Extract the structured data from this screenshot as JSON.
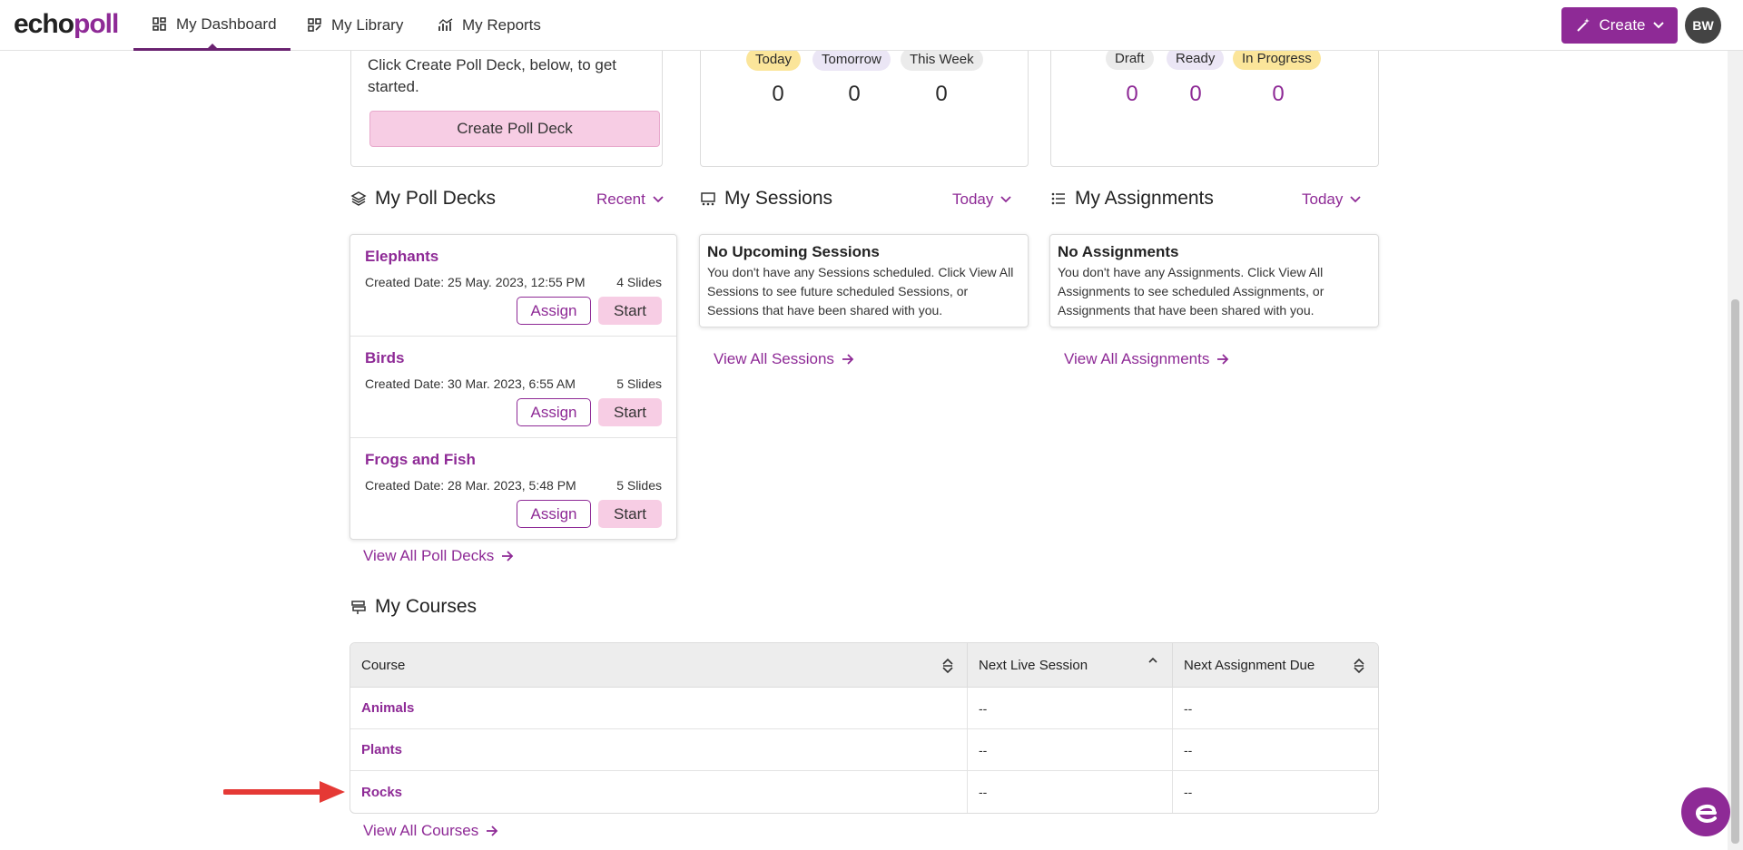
{
  "header": {
    "logo": {
      "part1": "echo",
      "part2": "poll"
    },
    "nav": [
      {
        "label": "My Dashboard",
        "icon": "dashboard-icon"
      },
      {
        "label": "My Library",
        "icon": "library-icon"
      },
      {
        "label": "My Reports",
        "icon": "reports-icon"
      }
    ],
    "create_label": "Create",
    "avatar_initials": "BW"
  },
  "getting_started": {
    "text": "Click Create Poll Deck, below, to get started.",
    "button": "Create Poll Deck"
  },
  "sessions_summary": {
    "filters": [
      "Today",
      "Tomorrow",
      "This Week"
    ],
    "counts": [
      "0",
      "0",
      "0"
    ]
  },
  "assignments_summary": {
    "filters": [
      "Draft",
      "Ready",
      "In Progress"
    ],
    "counts": [
      "0",
      "0",
      "0"
    ]
  },
  "poll_decks": {
    "title": "My Poll Decks",
    "filter": "Recent",
    "items": [
      {
        "name": "Elephants",
        "date": "Created Date: 25 May. 2023, 12:55 PM",
        "slides": "4 Slides"
      },
      {
        "name": "Birds",
        "date": "Created Date: 30 Mar. 2023, 6:55 AM",
        "slides": "5 Slides"
      },
      {
        "name": "Frogs and Fish",
        "date": "Created Date: 28 Mar. 2023, 5:48 PM",
        "slides": "5 Slides"
      }
    ],
    "assign_label": "Assign",
    "start_label": "Start",
    "view_all": "View All Poll Decks"
  },
  "sessions": {
    "title": "My Sessions",
    "filter": "Today",
    "empty_title": "No Upcoming Sessions",
    "empty_text": "You don't have any Sessions scheduled. Click View All Sessions to see future scheduled Sessions, or Sessions that have been shared with you.",
    "view_all": "View All Sessions"
  },
  "assignments": {
    "title": "My Assignments",
    "filter": "Today",
    "empty_title": "No Assignments",
    "empty_text": "You don't have any Assignments. Click View All Assignments to see scheduled Assignments, or Assignments that have been shared with you.",
    "view_all": "View All Assignments"
  },
  "courses": {
    "title": "My Courses",
    "columns": [
      "Course",
      "Next Live Session",
      "Next Assignment Due"
    ],
    "rows": [
      {
        "course": "Animals",
        "next_session": "--",
        "next_assignment": "--"
      },
      {
        "course": "Plants",
        "next_session": "--",
        "next_assignment": "--"
      },
      {
        "course": "Rocks",
        "next_session": "--",
        "next_assignment": "--"
      }
    ],
    "view_all": "View All Courses"
  },
  "colors": {
    "accent": "#8e2a96",
    "pink": "#f7cde4",
    "annotation_arrow": "#e53935"
  }
}
